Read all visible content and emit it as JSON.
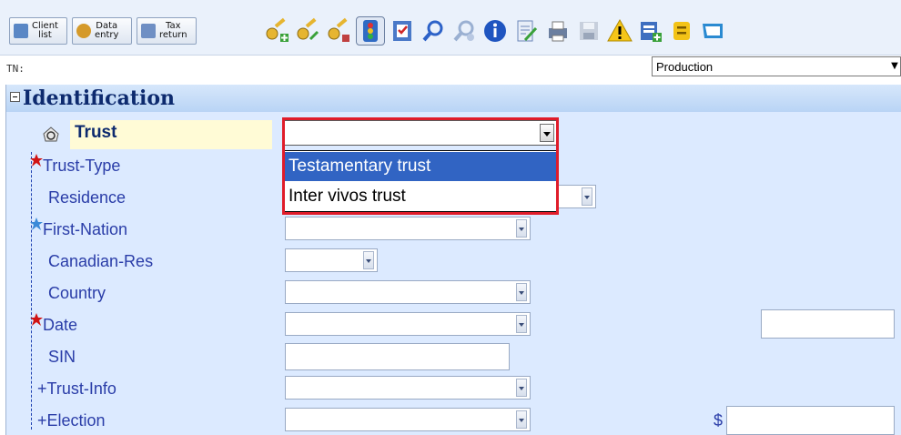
{
  "nav": {
    "client_list": "Client\nlist",
    "data_entry": "Data\nentry",
    "tax_return": "Tax\nreturn"
  },
  "toolbar_icons": [
    "key-add-icon",
    "key-icon",
    "key-edit-icon",
    "traffic-light-icon",
    "checklist-icon",
    "search-icon",
    "search-person-icon",
    "info-icon",
    "edit-document-icon",
    "print-icon",
    "save-icon",
    "warning-icon",
    "add-form-icon",
    "note-icon",
    "folder-icon"
  ],
  "tn_label": "TN:",
  "production_select": {
    "value": "Production"
  },
  "section": {
    "title": "Identification"
  },
  "trust": {
    "label": "Trust",
    "selected": "",
    "options": [
      "Testamentary trust",
      "Inter vivos trust"
    ]
  },
  "fields": {
    "trust_type": "Trust-Type",
    "residence": "Residence",
    "first_nation": "First-Nation",
    "canadian_res": "Canadian-Res",
    "country": "Country",
    "date": "Date",
    "sin": "SIN",
    "trust_info": "+Trust-Info",
    "election": "+Election"
  },
  "currency_symbol": "$",
  "colors": {
    "label_blue": "#2a3da8",
    "title_navy": "#0d2a6e",
    "form_bg": "#dceaff",
    "selection_blue": "#3164c3",
    "highlight_red": "#e01c2a",
    "required_red": "#d11414",
    "optional_blue": "#3a8ad8"
  }
}
